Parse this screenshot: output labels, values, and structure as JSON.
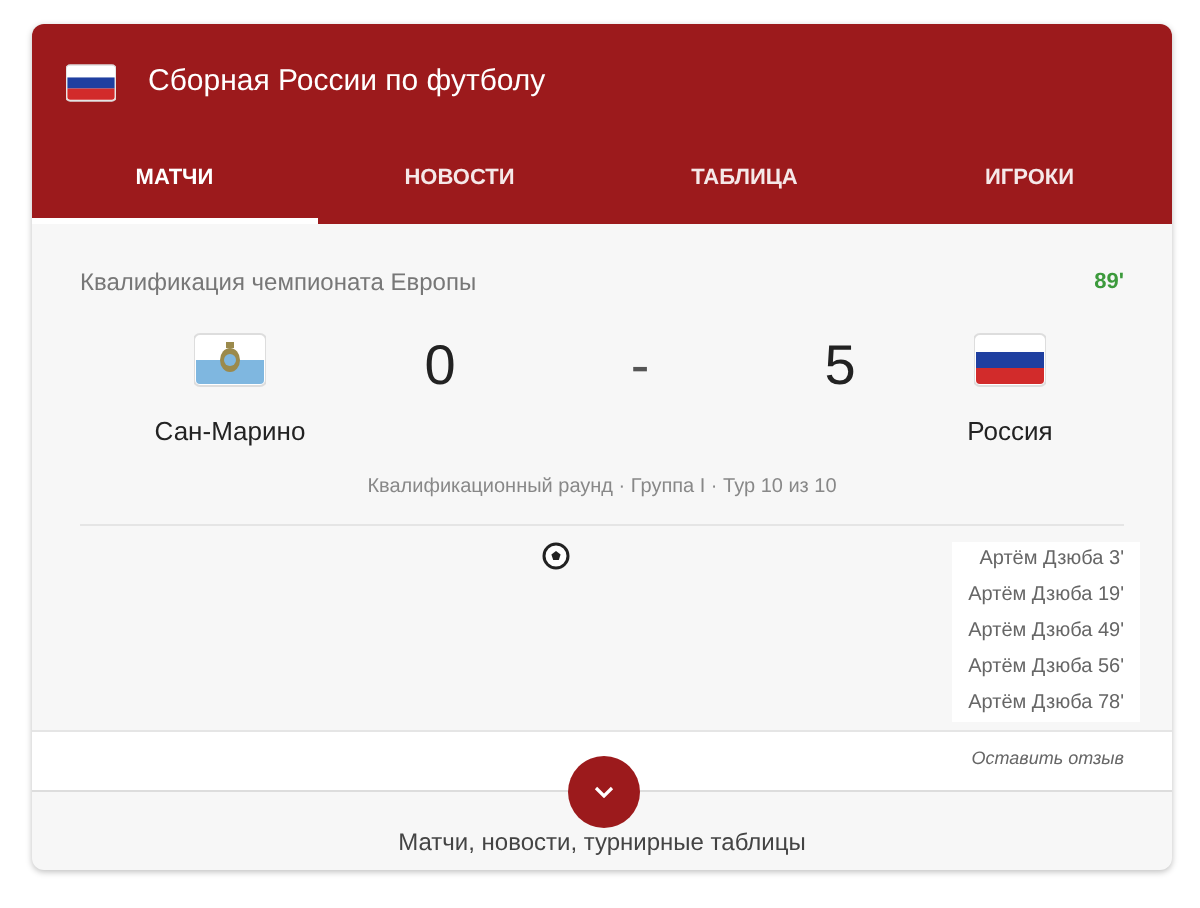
{
  "header": {
    "title": "Сборная России по футболу"
  },
  "tabs": [
    {
      "label": "МАТЧИ",
      "selected": true
    },
    {
      "label": "НОВОСТИ",
      "selected": false
    },
    {
      "label": "ТАБЛИЦА",
      "selected": false
    },
    {
      "label": "ИГРОКИ",
      "selected": false
    }
  ],
  "match": {
    "competition": "Квалификация чемпионата Европы",
    "minute": "89'",
    "live": true,
    "home": {
      "name": "Сан-Марино",
      "score": "0",
      "kind": "sanmarino"
    },
    "separator": "-",
    "away": {
      "name": "Россия",
      "score": "5",
      "kind": "russia"
    },
    "round": "Квалификационный раунд · Группа I · Тур 10 из 10",
    "scorers": [
      "Артём Дзюба 3'",
      "Артём Дзюба 19'",
      "Артём Дзюба 49'",
      "Артём Дзюба 56'",
      "Артём Дзюба 78'"
    ]
  },
  "feedback_link": "Оставить отзыв",
  "footer": {
    "text": "Матчи, новости, турнирные таблицы"
  }
}
